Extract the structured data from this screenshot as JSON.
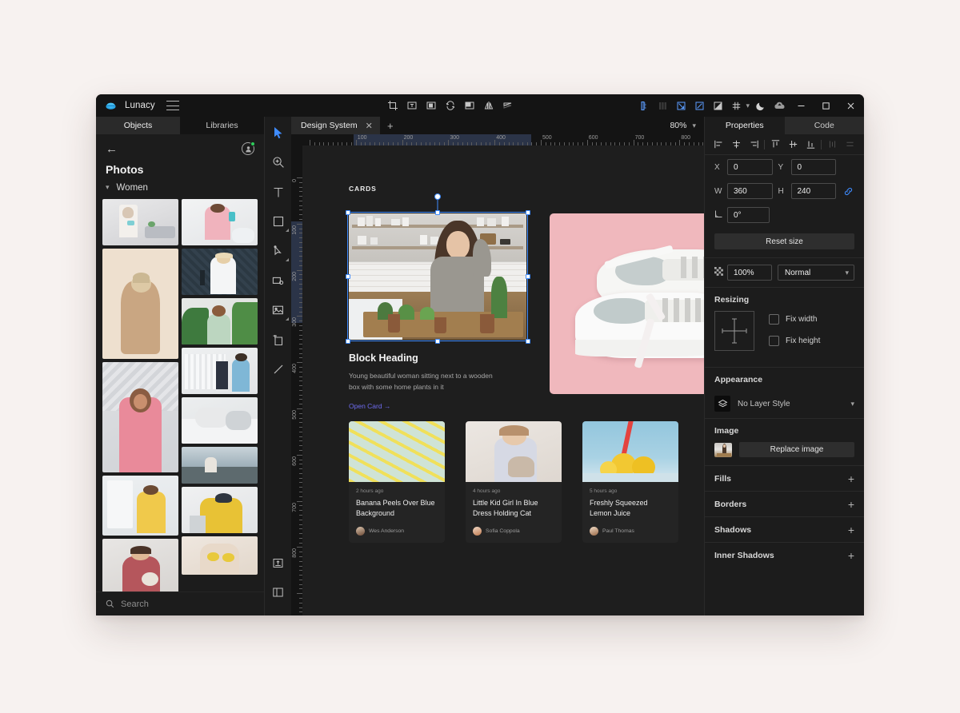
{
  "app": {
    "name": "Lunacy",
    "logo_icon": "lunacy-logo-icon",
    "menu_icon": "hamburger-menu-icon"
  },
  "titlebar": {
    "center_tools": [
      {
        "name": "crop-icon",
        "title": "Crop"
      },
      {
        "name": "text-frame-icon",
        "title": "Text frame"
      },
      {
        "name": "mask-icon",
        "title": "Mask"
      },
      {
        "name": "rotate-copy-icon",
        "title": "Rotate copies"
      },
      {
        "name": "union-icon",
        "title": "Boolean union"
      },
      {
        "name": "flip-horizontal-icon",
        "title": "Flip horizontal"
      },
      {
        "name": "flip-vertical-icon",
        "title": "Flip vertical"
      }
    ],
    "right_tools": [
      {
        "name": "ruler-icon",
        "title": "Rulers",
        "active": true
      },
      {
        "name": "columns-icon",
        "title": "Layout columns",
        "active": false
      },
      {
        "name": "pixel-grid-icon",
        "title": "Pixel grid",
        "active": true
      },
      {
        "name": "smart-guides-icon",
        "title": "Smart guides",
        "active": true
      },
      {
        "name": "contrast-icon",
        "title": "Contrast",
        "active": false
      },
      {
        "name": "grid-icon",
        "title": "Grid",
        "active": false
      },
      {
        "name": "chevron-down-icon",
        "title": "More"
      },
      {
        "name": "moon-icon",
        "title": "Dark mode"
      },
      {
        "name": "cloud-upload-icon",
        "title": "Cloud sync"
      }
    ],
    "window_controls": [
      {
        "name": "minimize-button",
        "glyph": "—"
      },
      {
        "name": "maximize-button",
        "glyph": "□"
      },
      {
        "name": "close-button",
        "glyph": "✕"
      }
    ]
  },
  "left_panel": {
    "tabs": [
      {
        "label": "Objects",
        "active": true
      },
      {
        "label": "Libraries",
        "active": false
      }
    ],
    "back_label": "←",
    "title": "Photos",
    "group": {
      "label": "Women",
      "expanded": true
    },
    "search": {
      "placeholder": "Search",
      "value": ""
    },
    "photos": [
      {
        "alt": "Woman holding teapot in living room",
        "h": 58,
        "col": 0
      },
      {
        "alt": "Woman in beige coat on beige background",
        "h": 138,
        "col": 0
      },
      {
        "alt": "Curly hair woman in pink dress",
        "h": 138,
        "col": 0
      },
      {
        "alt": "Woman in yellow dress in bathroom",
        "h": 75,
        "col": 0
      },
      {
        "alt": "Woman holding puppy",
        "h": 72,
        "col": 0
      },
      {
        "alt": "Woman cleaning bathroom",
        "h": 58,
        "col": 1
      },
      {
        "alt": "Blonde woman with headphones in studio",
        "h": 58,
        "col": 1
      },
      {
        "alt": "Woman with green plants",
        "h": 58,
        "col": 1
      },
      {
        "alt": "Woman sorting clothes on rack",
        "h": 58,
        "col": 1
      },
      {
        "alt": "Woman lying on bed with blanket",
        "h": 58,
        "col": 1
      },
      {
        "alt": "Woman on rocky shore",
        "h": 46,
        "col": 1
      },
      {
        "alt": "Woman in yellow raincoat sitting",
        "h": 58,
        "col": 1
      },
      {
        "alt": "Woman with lemons",
        "h": 48,
        "col": 1
      }
    ]
  },
  "tools": [
    {
      "name": "select-tool",
      "label": "Select",
      "active": true,
      "sub": false
    },
    {
      "name": "zoom-tool",
      "label": "Zoom",
      "active": false,
      "sub": false
    },
    {
      "name": "text-tool",
      "label": "Text",
      "active": false,
      "sub": false
    },
    {
      "name": "rectangle-tool",
      "label": "Rectangle",
      "active": false,
      "sub": true
    },
    {
      "name": "pen-tool",
      "label": "Pen",
      "active": false,
      "sub": true
    },
    {
      "name": "slice-tool",
      "label": "Slice",
      "active": false,
      "sub": false
    },
    {
      "name": "image-tool",
      "label": "Image",
      "active": false,
      "sub": true
    },
    {
      "name": "artboard-tool",
      "label": "Artboard",
      "active": false,
      "sub": false
    },
    {
      "name": "line-tool",
      "label": "Line",
      "active": false,
      "sub": false
    }
  ],
  "tools_bottom": [
    {
      "name": "export-tool",
      "label": "Export"
    },
    {
      "name": "toggle-panels-tool",
      "label": "Toggle panels"
    }
  ],
  "canvas": {
    "tabs": [
      {
        "label": "Design System",
        "active": true,
        "close_icon": "close-icon"
      }
    ],
    "add_tab_icon": "plus-icon",
    "zoom": "80%",
    "zoom_chevron_icon": "chevron-down-icon",
    "ruler_h_labels": [
      "100",
      "200",
      "300",
      "400",
      "500",
      "600",
      "700",
      "800"
    ],
    "ruler_v_labels": [
      "0",
      "100",
      "200",
      "300",
      "400",
      "500",
      "600",
      "700",
      "800"
    ],
    "section_label": "CARDS",
    "big_card": {
      "image_alt": "Young woman sitting at wooden table with potted plants",
      "heading": "Block Heading",
      "body": "Young beautiful woman sitting next to a wooden box with some home plants in it",
      "link": "Open Card →",
      "selected": true
    },
    "shoe_card": {
      "image_alt": "White sneakers on pink background"
    },
    "mini_cards": [
      {
        "time": "2 hours ago",
        "title": "Banana Peels Over Blue Background",
        "author": "Wes Anderson",
        "image_alt": "Banana pattern on blue background"
      },
      {
        "time": "4 hours ago",
        "title": "Little Kid Girl In Blue Dress Holding Cat",
        "author": "Sofia Coppola",
        "image_alt": "Little girl holding a cat"
      },
      {
        "time": "5 hours ago",
        "title": "Freshly Squeezed Lemon Juice",
        "author": "Paul Thomas",
        "image_alt": "Lemons and juice glass with red straw"
      }
    ]
  },
  "right_panel": {
    "tabs": [
      {
        "label": "Properties",
        "active": true
      },
      {
        "label": "Code",
        "active": false
      }
    ],
    "align_buttons": [
      {
        "name": "align-left-icon"
      },
      {
        "name": "align-center-horizontal-icon"
      },
      {
        "name": "align-right-icon"
      },
      {
        "name": "align-top-icon"
      },
      {
        "name": "align-center-vertical-icon"
      },
      {
        "name": "align-bottom-icon"
      },
      {
        "name": "distribute-horizontal-icon"
      },
      {
        "name": "distribute-vertical-icon"
      }
    ],
    "geometry": {
      "x_label": "X",
      "x_value": "0",
      "y_label": "Y",
      "y_value": "0",
      "w_label": "W",
      "w_value": "360",
      "h_label": "H",
      "h_value": "240",
      "link_icon": "link-icon",
      "rotation_label": "rotation-icon",
      "rotation_value": "0°",
      "reset_label": "Reset size"
    },
    "blend": {
      "opacity_icon": "opacity-icon",
      "opacity_value": "100%",
      "mode_value": "Normal",
      "mode_chevron_icon": "chevron-down-icon"
    },
    "resizing": {
      "title": "Resizing",
      "constraints_icon": "resize-constraints-icon",
      "fix_width_label": "Fix width",
      "fix_width_checked": false,
      "fix_height_label": "Fix height",
      "fix_height_checked": false
    },
    "appearance": {
      "title": "Appearance",
      "layer_style_icon": "layer-style-icon",
      "layer_style_value": "No Layer Style",
      "chevron_icon": "chevron-down-icon"
    },
    "image": {
      "title": "Image",
      "thumb_alt": "Selected image thumbnail",
      "replace_label": "Replace image"
    },
    "sections": [
      {
        "label": "Fills",
        "add_icon": "plus-icon"
      },
      {
        "label": "Borders",
        "add_icon": "plus-icon"
      },
      {
        "label": "Shadows",
        "add_icon": "plus-icon"
      },
      {
        "label": "Inner Shadows",
        "add_icon": "plus-icon"
      }
    ]
  },
  "colors": {
    "accent": "#3f8cff",
    "link": "#6e6cf0",
    "window_bg": "#1c1c1c",
    "titlebar_bg": "#141414",
    "canvas_bg": "#1e1e1e",
    "page_bg": "#f7f2f0",
    "online_dot": "#2ecc5a"
  }
}
